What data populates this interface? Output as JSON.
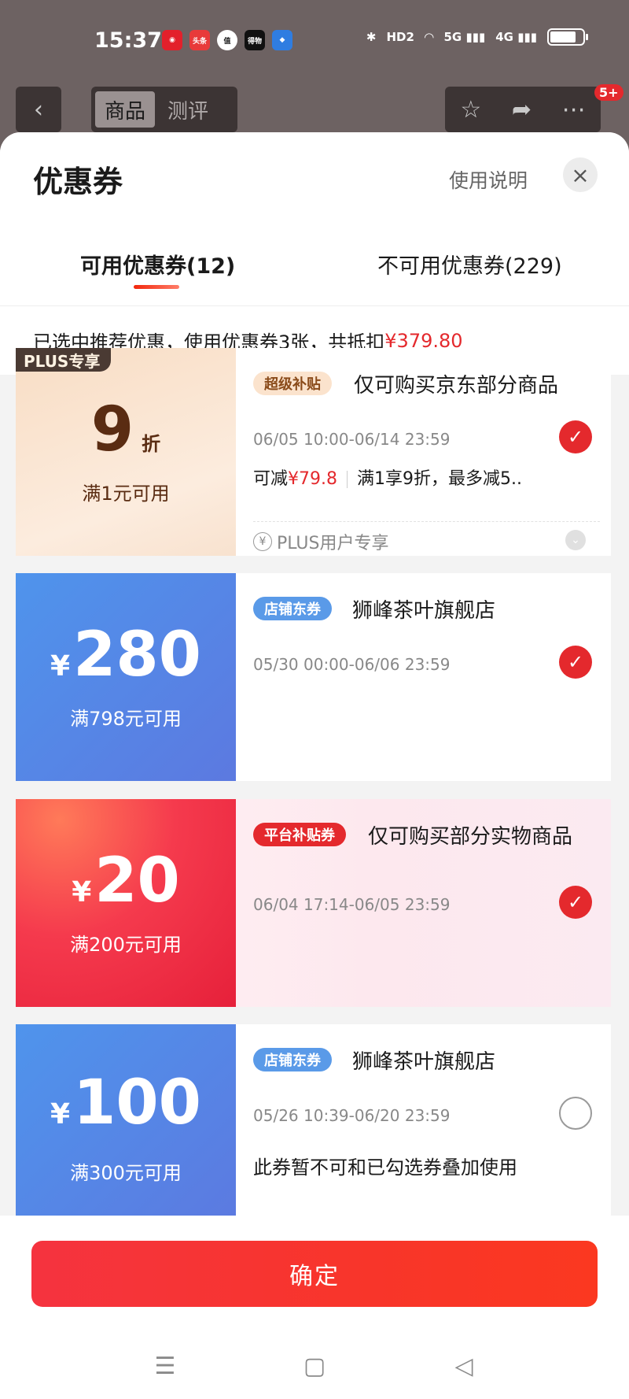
{
  "status_bar": {
    "time": "15:37",
    "app_icons": [
      {
        "label": "",
        "color": "#e3202b",
        "icon": "netease-music-icon"
      },
      {
        "label": "头条",
        "color": "#e83a3a",
        "icon": "toutiao-icon"
      },
      {
        "label": "值",
        "color": "#ffffff",
        "icon": "smzdm-icon"
      },
      {
        "label": "得物",
        "color": "#111111",
        "icon": "dewu-icon"
      },
      {
        "label": "",
        "color": "#2f7de1",
        "icon": "app-icon"
      }
    ],
    "network_labels": [
      "HD2",
      "5G",
      "4G"
    ]
  },
  "background_nav": {
    "back_glyph": "‹",
    "tabs": [
      {
        "label": "商品",
        "active": true
      },
      {
        "label": "测评",
        "active": false
      }
    ],
    "badge": "5+"
  },
  "sheet": {
    "title": "优惠券",
    "help_link": "使用说明",
    "close_glyph": "×",
    "tabs": [
      {
        "label": "可用优惠券(12)",
        "active": true
      },
      {
        "label": "不可用优惠券(229)",
        "active": false
      }
    ],
    "summary": {
      "text": "已选中推荐优惠，使用优惠券3张，共抵扣",
      "amount": "¥379.80"
    }
  },
  "coupons": [
    {
      "badge": "PLUS专享",
      "amount": "9",
      "unit": "折",
      "condition": "满1元可用",
      "tag": "超级补贴",
      "name": "仅可购买京东部分商品",
      "date": "06/05 10:00-06/14 23:59",
      "saving_label": "可减",
      "saving_amount": "¥79.8",
      "detail": "满1享9折，最多减5..",
      "footer": "PLUS用户专享",
      "selected": true
    },
    {
      "currency": "¥",
      "amount": "280",
      "condition": "满798元可用",
      "tag": "店铺东券",
      "name": "狮峰茶叶旗舰店",
      "date": "05/30 00:00-06/06 23:59",
      "selected": true
    },
    {
      "currency": "¥",
      "amount": "20",
      "condition": "满200元可用",
      "tag": "平台补贴券",
      "name": "仅可购买部分实物商品",
      "date": "06/04 17:14-06/05 23:59",
      "selected": true
    },
    {
      "currency": "¥",
      "amount": "100",
      "condition": "满300元可用",
      "tag": "店铺东券",
      "name": "狮峰茶叶旗舰店",
      "date": "05/26 10:39-06/20 23:59",
      "note": "此券暂不可和已勾选券叠加使用",
      "selected": false
    }
  ],
  "confirm_button": "确定",
  "colors": {
    "accent_red": "#e4292d",
    "blue_coupon": "#5a86e4",
    "plus_gold": "#f8ddc4"
  }
}
